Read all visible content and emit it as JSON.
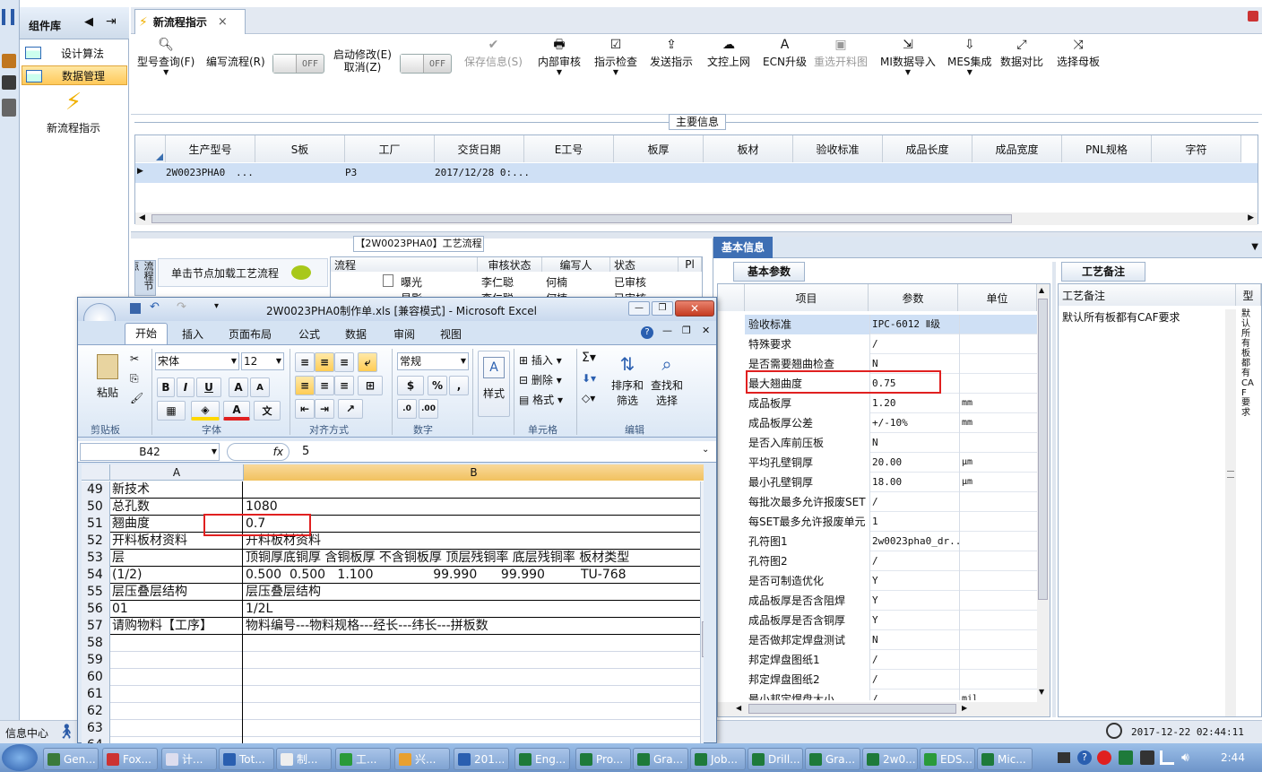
{
  "app": {
    "rail_icon": "menu-icon"
  },
  "components": {
    "title": "组件库",
    "items": [
      {
        "label": "设计算法",
        "icon": "table-icon"
      },
      {
        "label": "数据管理",
        "icon": "table-icon"
      }
    ],
    "big_item": {
      "label": "新流程指示",
      "icon": "lightning-icon"
    }
  },
  "doc_tab": {
    "label": "新流程指示",
    "close": "×"
  },
  "toolbar": {
    "query": "型号查询(F)",
    "write_flow": "编写流程(R)",
    "toggle_off": "OFF",
    "start_edit": "启动修改(E)",
    "cancel_edit": "取消(Z)",
    "save": "保存信息(S)",
    "review": "内部审核",
    "check": "指示检查",
    "send": "发送指示",
    "upload": "文控上网",
    "ecn": "ECN升级",
    "reselect": "重选开料图",
    "mi_import": "MI数据导入",
    "mes": "MES集成",
    "compare": "数据对比",
    "mother": "选择母板"
  },
  "main_info": {
    "title": "主要信息",
    "columns": [
      "生产型号",
      "S板",
      "工厂",
      "交货日期",
      "E工号",
      "板厚",
      "板材",
      "验收标准",
      "成品长度",
      "成品宽度",
      "PNL规格",
      "字符"
    ],
    "row": {
      "model": "2W0023PHA0",
      "dots": "...",
      "factory": "P3",
      "date": "2017/12/28 0:..."
    }
  },
  "flow_panel": {
    "title": "【2W0023PHA0】工艺流程",
    "load_text": "单击节点加载工艺流程",
    "side_label": "流程节点",
    "columns": [
      "流程",
      "审核状态",
      "编写人",
      "状态",
      "Pl"
    ],
    "rows": [
      {
        "step": "曝光",
        "reviewer": "李仁聪",
        "author": "何楠",
        "status": "已审核"
      },
      {
        "step": "显影",
        "reviewer": "李仁聪",
        "author": "何楠",
        "status": "已审核"
      }
    ]
  },
  "basic_info": {
    "title": "基本信息",
    "tab": "基本参数",
    "columns": [
      "项目",
      "参数",
      "单位"
    ],
    "rows": [
      {
        "item": "验收标准",
        "value": "IPC-6012 Ⅱ级",
        "unit": ""
      },
      {
        "item": "特殊要求",
        "value": "/",
        "unit": ""
      },
      {
        "item": "是否需要翘曲检查",
        "value": "N",
        "unit": ""
      },
      {
        "item": "最大翘曲度",
        "value": "0.75",
        "unit": ""
      },
      {
        "item": "成品板厚",
        "value": "1.20",
        "unit": "mm"
      },
      {
        "item": "成品板厚公差",
        "value": "+/-10%",
        "unit": "mm"
      },
      {
        "item": "是否入库前压板",
        "value": "N",
        "unit": ""
      },
      {
        "item": "平均孔壁铜厚",
        "value": "20.00",
        "unit": "μm"
      },
      {
        "item": "最小孔壁铜厚",
        "value": "18.00",
        "unit": "μm"
      },
      {
        "item": "每批次最多允许报废SET",
        "value": "/",
        "unit": ""
      },
      {
        "item": "每SET最多允许报废单元",
        "value": "1",
        "unit": ""
      },
      {
        "item": "孔符图1",
        "value": "2w0023pha0_dr...",
        "unit": ""
      },
      {
        "item": "孔符图2",
        "value": "/",
        "unit": ""
      },
      {
        "item": "是否可制造优化",
        "value": "Y",
        "unit": ""
      },
      {
        "item": "成品板厚是否含阻焊",
        "value": "Y",
        "unit": ""
      },
      {
        "item": "成品板厚是否含铜厚",
        "value": "Y",
        "unit": ""
      },
      {
        "item": "是否做邦定焊盘测试",
        "value": "N",
        "unit": ""
      },
      {
        "item": "邦定焊盘图纸1",
        "value": "/",
        "unit": ""
      },
      {
        "item": "邦定焊盘图纸2",
        "value": "/",
        "unit": ""
      },
      {
        "item": "最小邦定焊盘大小",
        "value": "/",
        "unit": "mil"
      }
    ]
  },
  "remarks": {
    "tab": "工艺备注",
    "header": "工艺备注",
    "header2": "型",
    "text": "默认所有板都有CAF要求",
    "vertical": "默认所有板都有CAF要求"
  },
  "status": {
    "info_center": "信息中心",
    "datetime": "2017-12-22 02:44:11"
  },
  "excel": {
    "title": "2W0023PHA0制作单.xls [兼容模式] - Microsoft Excel",
    "tabs": [
      "开始",
      "插入",
      "页面布局",
      "公式",
      "数据",
      "审阅",
      "视图"
    ],
    "groups": {
      "clipboard": "剪贴板",
      "font": "字体",
      "align": "对齐方式",
      "number": "数字",
      "style": "样式",
      "cells": "单元格",
      "edit": "编辑"
    },
    "paste": "粘贴",
    "font_name": "宋体",
    "font_size": "12",
    "number_format": "常规",
    "style_label": "样式",
    "cells_btns": [
      "插入",
      "删除",
      "格式"
    ],
    "sort": "排序和",
    "sort2": "筛选",
    "find": "查找和",
    "find2": "选择",
    "name_box": "B42",
    "fx": "fx",
    "formula_value": "5",
    "col_a": "A",
    "col_b": "B",
    "rows": [
      {
        "n": "49",
        "a": "新技术",
        "b": ""
      },
      {
        "n": "50",
        "a": "总孔数",
        "b": "1080"
      },
      {
        "n": "51",
        "a": "翘曲度",
        "b": "0.7"
      },
      {
        "n": "52",
        "a": "开料板材资料",
        "b": "开料板材资料"
      },
      {
        "n": "53",
        "a": "层",
        "b": "顶铜厚底铜厚 含铜板厚 不含铜板厚 顶层残铜率 底层残铜率 板材类型"
      },
      {
        "n": "54",
        "a": "(1/2)",
        "b": "0.500  0.500   1.100               99.990      99.990         TU-768"
      },
      {
        "n": "55",
        "a": "层压叠层结构",
        "b": "层压叠层结构"
      },
      {
        "n": "56",
        "a": "01",
        "b": "1/2L"
      },
      {
        "n": "57",
        "a": "请购物料【工序】",
        "b": "物料编号---物料规格---经长---纬长---拼板数"
      },
      {
        "n": "58",
        "a": "",
        "b": ""
      },
      {
        "n": "59",
        "a": "",
        "b": ""
      },
      {
        "n": "60",
        "a": "",
        "b": ""
      },
      {
        "n": "61",
        "a": "",
        "b": ""
      },
      {
        "n": "62",
        "a": "",
        "b": ""
      },
      {
        "n": "63",
        "a": "",
        "b": ""
      },
      {
        "n": "64",
        "a": "",
        "b": ""
      }
    ]
  },
  "taskbar": {
    "items": [
      {
        "label": "Gen...",
        "color": "#3a7a3a"
      },
      {
        "label": "Fox...",
        "color": "#c33"
      },
      {
        "label": "计...",
        "color": "#dde"
      },
      {
        "label": "Tot...",
        "color": "#2a5fb0"
      },
      {
        "label": "制...",
        "color": "#eee"
      },
      {
        "label": "工...",
        "color": "#2a9a3a"
      },
      {
        "label": "兴...",
        "color": "#e8a030"
      },
      {
        "label": "201...",
        "color": "#2a5fb0"
      },
      {
        "label": "Eng...",
        "color": "#1e7a3a"
      },
      {
        "label": "Pro...",
        "color": "#1e7a3a"
      },
      {
        "label": "Gra...",
        "color": "#1e7a3a"
      },
      {
        "label": "Job...",
        "color": "#1e7a3a"
      },
      {
        "label": "Drill...",
        "color": "#1e7a3a"
      },
      {
        "label": "Gra...",
        "color": "#1e7a3a"
      },
      {
        "label": "2w0...",
        "color": "#1e7a3a"
      },
      {
        "label": "EDS...",
        "color": "#2a9a3a"
      },
      {
        "label": "Mic...",
        "color": "#1e7a3a"
      }
    ],
    "clock": "2:44"
  }
}
